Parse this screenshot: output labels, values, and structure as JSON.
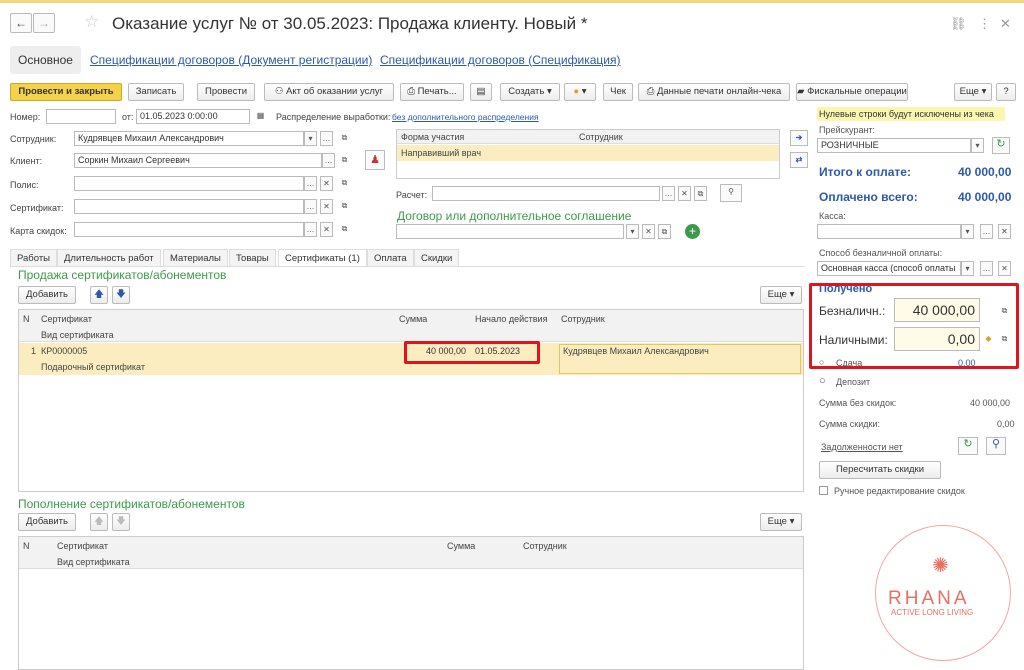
{
  "window": {
    "title": "Оказание услуг № от 30.05.2023: Продажа клиенту. Новый *"
  },
  "tabs": [
    "Основное",
    "Спецификации договоров (Документ регистрации)",
    "Спецификации договоров (Спецификация)"
  ],
  "toolbar": {
    "post_close": "Провести и закрыть",
    "save": "Записать",
    "post": "Провести",
    "act": "Акт об оказании услуг",
    "print": "Печать...",
    "create": "Создать",
    "check": "Чек",
    "online_print": "Данные печати онлайн-чека",
    "fiscal": "Фискальные операции",
    "more": "Еще"
  },
  "header": {
    "number_label": "Номер:",
    "date_label": "от:",
    "date_value": "01.05.2023  0:00:00",
    "distribution_label": "Распределение выработки:",
    "distribution_link": "без дополнительного распределения"
  },
  "fields": {
    "employee_label": "Сотрудник:",
    "employee_value": "Кудрявцев Михаил Александрович",
    "client_label": "Клиент:",
    "client_value": "Соркин Михаил Сергеевич",
    "policy_label": "Полис:",
    "certificate_label": "Сертификат:",
    "card_label": "Карта скидок:"
  },
  "participation": {
    "col1": "Форма участия",
    "col2": "Сотрудник",
    "row1": "Направивший врач"
  },
  "calc_label": "Расчет:",
  "contract_label": "Договор или дополнительное соглашение",
  "work_tabs": [
    "Работы",
    "Длительность работ",
    "Материалы",
    "Товары",
    "Сертификаты (1)",
    "Оплата",
    "Скидки"
  ],
  "sales": {
    "title": "Продажа сертификатов/абонементов",
    "add": "Добавить",
    "more": "Еще",
    "headers": {
      "n": "N",
      "cert": "Сертификат",
      "cert_type": "Вид сертификата",
      "sum": "Сумма",
      "start": "Начало действия",
      "emp": "Сотрудник"
    },
    "rows": [
      {
        "n": "1",
        "cert": "КР0000005",
        "cert_type": "Подарочный сертификат",
        "sum": "40 000,00",
        "start": "01.05.2023",
        "emp": "Кудрявцев Михаил Александрович"
      }
    ]
  },
  "replenish": {
    "title": "Пополнение сертификатов/абонементов",
    "add": "Добавить",
    "more": "Еще",
    "headers": {
      "n": "N",
      "cert": "Сертификат",
      "cert_type": "Вид сертификата",
      "sum": "Сумма",
      "emp": "Сотрудник"
    }
  },
  "right": {
    "notice": "Нулевые строки будут исключены из чека",
    "price_label": "Прейскурант:",
    "price_value": "РОЗНИЧНЫЕ",
    "total_label": "Итого к оплате:",
    "total_value": "40 000,00",
    "paid_label": "Оплачено всего:",
    "paid_value": "40 000,00",
    "cash_label": "Касса:",
    "method_label": "Способ безналичной оплаты:",
    "method_value": "Основная касса (способ оплаты",
    "received_label": "Получено",
    "noncash_label": "Безналичн.:",
    "noncash_value": "40 000,00",
    "cash2_label": "Наличными:",
    "cash2_value": "0,00",
    "change_label": "Сдача",
    "change_value": "0,00",
    "deposit_label": "Депозит",
    "sum_no_disc_label": "Сумма без скидок:",
    "sum_no_disc_value": "40 000,00",
    "disc_label": "Сумма скидки:",
    "disc_value": "0,00",
    "debt": "Задолженности нет",
    "recalc": "Пересчитать скидки",
    "manual": "Ручное редактирование скидок"
  },
  "watermark": {
    "brand": "RHANA",
    "tagline": "ACTIVE LONG LIVING"
  },
  "colors": {
    "accent": "#f6d24a",
    "link": "#2a5aa8",
    "highlight": "#e0141e",
    "green": "#3c9a4b"
  }
}
